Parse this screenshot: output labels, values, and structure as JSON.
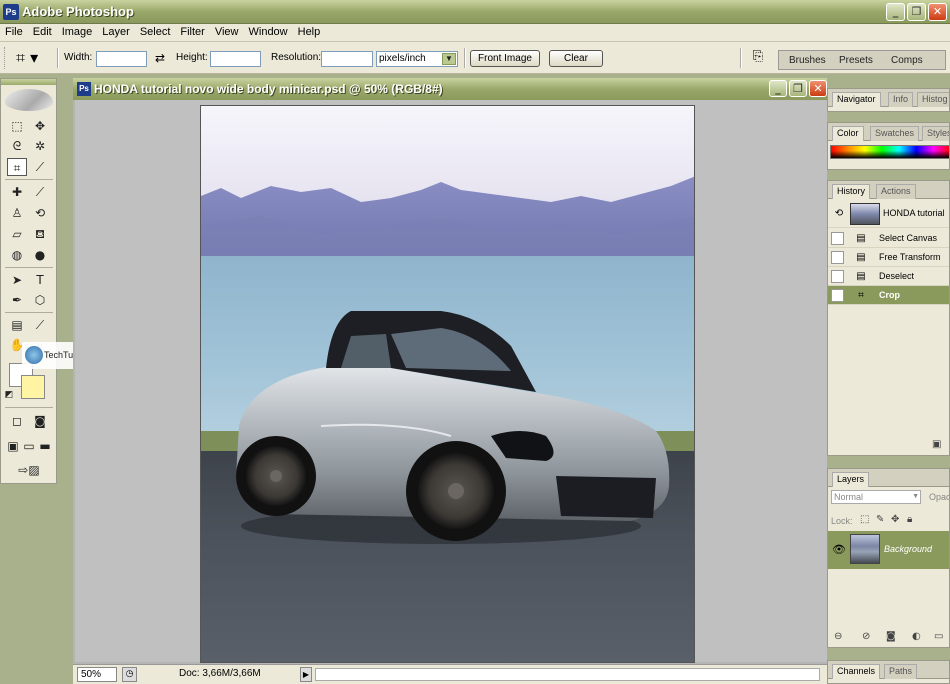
{
  "window": {
    "title": "Adobe Photoshop",
    "app_icon": "Ps",
    "controls": {
      "minimize": "_",
      "maximize": "❐",
      "close": "✕"
    }
  },
  "menu": [
    "File",
    "Edit",
    "Image",
    "Layer",
    "Select",
    "Filter",
    "View",
    "Window",
    "Help"
  ],
  "options_bar": {
    "width_label": "Width:",
    "width_value": "",
    "height_label": "Height:",
    "height_value": "",
    "resolution_label": "Resolution:",
    "resolution_value": "",
    "units_value": "pixels/inch",
    "front_image_label": "Front Image",
    "clear_label": "Clear",
    "palette_well": [
      "Brushes",
      "Presets",
      "Comps"
    ]
  },
  "watermark": {
    "text": "TechTut.com"
  },
  "document": {
    "title": "HONDA tutorial novo wide body minicar.psd @ 50% (RGB/8#)",
    "doc_icon": "Ps",
    "zoom": "50%",
    "doc_size": "Doc: 3,66M/3,66M"
  },
  "panels": {
    "navigator_tabs": [
      "Navigator",
      "Info",
      "Histog"
    ],
    "color_tabs": [
      "Color",
      "Swatches",
      "Styles"
    ],
    "history_tabs": [
      "History",
      "Actions"
    ],
    "history_snapshot": "HONDA tutorial",
    "history_items": [
      {
        "label": "Select Canvas",
        "active": false
      },
      {
        "label": "Free Transform",
        "active": false
      },
      {
        "label": "Deselect",
        "active": false
      },
      {
        "label": "Crop",
        "active": true
      }
    ],
    "layers_tab": "Layers",
    "blend_mode": "Normal",
    "opacity_label": "Opac",
    "lock_label": "Lock:",
    "layer_name": "Background",
    "bottom_tabs": [
      "Channels",
      "Paths"
    ]
  },
  "colors": {
    "titlebar": "#9aa86a",
    "chrome": "#ece9d8",
    "selection": "#8a9a5c",
    "foreground": "#ffffff",
    "background_swatch": "#fef4a4"
  }
}
